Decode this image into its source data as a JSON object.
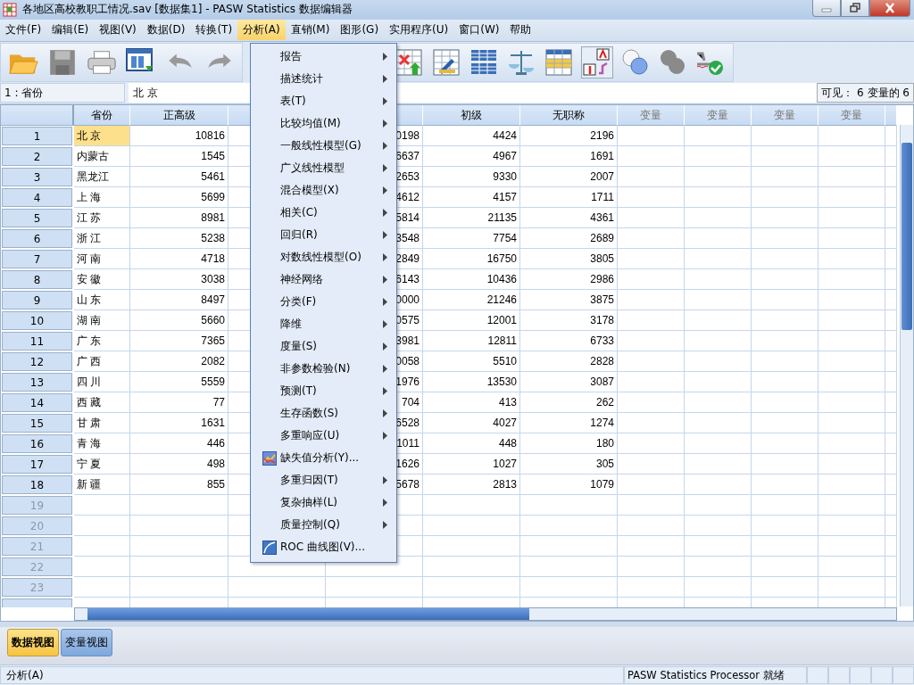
{
  "window": {
    "title": "各地区高校教职工情况.sav [数据集1] - PASW Statistics 数据编辑器"
  },
  "menubar": [
    {
      "label": "文件(F)",
      "selected": false
    },
    {
      "label": "编辑(E)",
      "selected": false
    },
    {
      "label": "视图(V)",
      "selected": false
    },
    {
      "label": "数据(D)",
      "selected": false
    },
    {
      "label": "转换(T)",
      "selected": false
    },
    {
      "label": "分析(A)",
      "selected": true
    },
    {
      "label": "直销(M)",
      "selected": false
    },
    {
      "label": "图形(G)",
      "selected": false
    },
    {
      "label": "实用程序(U)",
      "selected": false
    },
    {
      "label": "窗口(W)",
      "selected": false
    },
    {
      "label": "帮助",
      "selected": false
    }
  ],
  "toolbar": {
    "value_labels": {
      "on": true
    }
  },
  "cell_editor": {
    "reference": "1 : 省份",
    "value": "北 京",
    "visible": "可见： 6 变量的 6"
  },
  "table": {
    "columns": [
      {
        "kind": "data",
        "label": "省份"
      },
      {
        "kind": "data",
        "label": "正高级"
      },
      {
        "kind": "data"
      },
      {
        "kind": "data"
      },
      {
        "kind": "data",
        "label": "初级"
      },
      {
        "kind": "data",
        "label": "无职称"
      },
      {
        "kind": "variable",
        "label": "变量"
      },
      {
        "kind": "variable",
        "label": "变量"
      },
      {
        "kind": "variable",
        "label": "变量"
      },
      {
        "kind": "variable",
        "label": "变量"
      }
    ],
    "rows": [
      {
        "number": "1",
        "selected": true,
        "cells": [
          "北 京",
          "10816",
          null,
          "0198",
          "4424",
          "2196"
        ]
      },
      {
        "number": "2",
        "selected": false,
        "cells": [
          "内蒙古",
          "1545",
          null,
          "6637",
          "4967",
          "1691"
        ]
      },
      {
        "number": "3",
        "selected": false,
        "cells": [
          "黑龙江",
          "5461",
          null,
          "2653",
          "9330",
          "2007"
        ]
      },
      {
        "number": "4",
        "selected": false,
        "cells": [
          "上 海",
          "5699",
          null,
          "4612",
          "4157",
          "1711"
        ]
      },
      {
        "number": "5",
        "selected": false,
        "cells": [
          "江 苏",
          "8981",
          null,
          "5814",
          "21135",
          "4361"
        ]
      },
      {
        "number": "6",
        "selected": false,
        "cells": [
          "浙 江",
          "5238",
          null,
          "3548",
          "7754",
          "2689"
        ]
      },
      {
        "number": "7",
        "selected": false,
        "cells": [
          "河 南",
          "4718",
          null,
          "2849",
          "16750",
          "3805"
        ]
      },
      {
        "number": "8",
        "selected": false,
        "cells": [
          "安 徽",
          "3038",
          null,
          "6143",
          "10436",
          "2986"
        ]
      },
      {
        "number": "9",
        "selected": false,
        "cells": [
          "山 东",
          "8497",
          null,
          "0000",
          "21246",
          "3875"
        ]
      },
      {
        "number": "10",
        "selected": false,
        "cells": [
          "湖 南",
          "5660",
          null,
          "0575",
          "12001",
          "3178"
        ]
      },
      {
        "number": "11",
        "selected": false,
        "cells": [
          "广 东",
          "7365",
          null,
          "3981",
          "12811",
          "6733"
        ]
      },
      {
        "number": "12",
        "selected": false,
        "cells": [
          "广 西",
          "2082",
          null,
          "0058",
          "5510",
          "2828"
        ]
      },
      {
        "number": "13",
        "selected": false,
        "cells": [
          "四 川",
          "5559",
          null,
          "1976",
          "13530",
          "3087"
        ]
      },
      {
        "number": "14",
        "selected": false,
        "cells": [
          "西 藏",
          "77",
          null,
          "704",
          "413",
          "262"
        ]
      },
      {
        "number": "15",
        "selected": false,
        "cells": [
          "甘 肃",
          "1631",
          null,
          "6528",
          "4027",
          "1274"
        ]
      },
      {
        "number": "16",
        "selected": false,
        "cells": [
          "青 海",
          "446",
          null,
          "1011",
          "448",
          "180"
        ]
      },
      {
        "number": "17",
        "selected": false,
        "cells": [
          "宁 夏",
          "498",
          null,
          "1626",
          "1027",
          "305"
        ]
      },
      {
        "number": "18",
        "selected": false,
        "cells": [
          "新 疆",
          "855",
          null,
          "5678",
          "2813",
          "1079"
        ]
      },
      {
        "number": "19",
        "selected": false
      },
      {
        "number": "20",
        "selected": false
      },
      {
        "number": "21",
        "selected": false
      },
      {
        "number": "22",
        "selected": false
      },
      {
        "number": "23",
        "selected": false
      }
    ]
  },
  "menu": [
    {
      "label": "报告",
      "kind": "submenu"
    },
    {
      "label": "描述统计",
      "kind": "submenu"
    },
    {
      "label": "表(T)",
      "kind": "submenu"
    },
    {
      "label": "比较均值(M)",
      "kind": "submenu"
    },
    {
      "label": "一般线性模型(G)",
      "kind": "submenu"
    },
    {
      "label": "广义线性模型",
      "kind": "submenu"
    },
    {
      "label": "混合模型(X)",
      "kind": "submenu"
    },
    {
      "label": "相关(C)",
      "kind": "submenu"
    },
    {
      "label": "回归(R)",
      "kind": "submenu"
    },
    {
      "label": "对数线性模型(O)",
      "kind": "submenu"
    },
    {
      "label": "神经网络",
      "kind": "submenu"
    },
    {
      "label": "分类(F)",
      "kind": "submenu"
    },
    {
      "label": "降维",
      "kind": "submenu"
    },
    {
      "label": "度量(S)",
      "kind": "submenu"
    },
    {
      "label": "非参数检验(N)",
      "kind": "submenu"
    },
    {
      "label": "预测(T)",
      "kind": "submenu"
    },
    {
      "label": "生存函数(S)",
      "kind": "submenu"
    },
    {
      "label": "多重响应(U)",
      "kind": "submenu"
    },
    {
      "label": "缺失值分析(Y)...",
      "kind": "missing"
    },
    {
      "label": "多重归因(T)",
      "kind": "submenu"
    },
    {
      "label": "复杂抽样(L)",
      "kind": "submenu"
    },
    {
      "label": "质量控制(Q)",
      "kind": "submenu"
    },
    {
      "label": "ROC 曲线图(V)...",
      "kind": "roc"
    }
  ],
  "view_tabs": [
    {
      "label": "数据视图",
      "selected": true
    },
    {
      "label": "变量视图",
      "selected": false
    }
  ],
  "status_bar": {
    "message": "分析(A)",
    "processor": "PASW Statistics Processor 就绪"
  }
}
